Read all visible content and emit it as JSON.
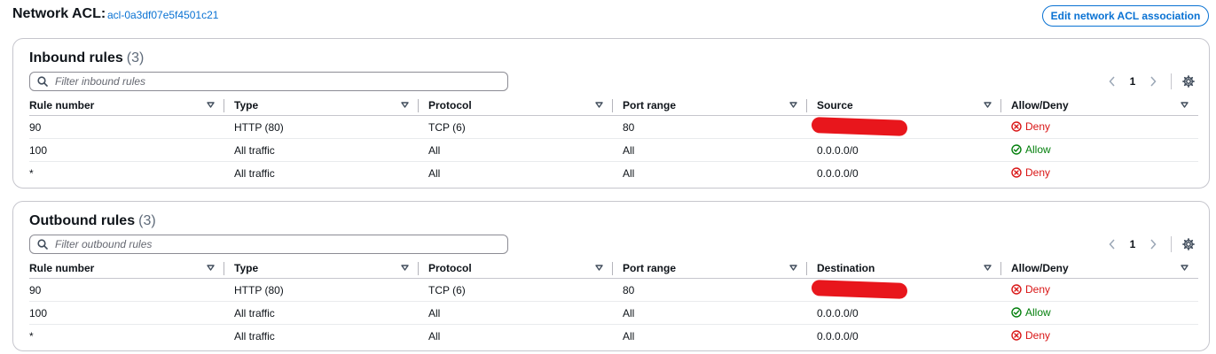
{
  "header": {
    "title": "Network ACL:",
    "acl_id": "acl-0a3df07e5f4501c21",
    "edit_button": "Edit network ACL association"
  },
  "inbound": {
    "title": "Inbound rules",
    "count": "(3)",
    "filter_placeholder": "Filter inbound rules",
    "page": "1",
    "columns": [
      "Rule number",
      "Type",
      "Protocol",
      "Port range",
      "Source",
      "Allow/Deny"
    ],
    "rows": [
      {
        "rule": "90",
        "type": "HTTP (80)",
        "protocol": "TCP (6)",
        "port": "80",
        "addr": "",
        "addr_redacted": true,
        "action": "Deny"
      },
      {
        "rule": "100",
        "type": "All traffic",
        "protocol": "All",
        "port": "All",
        "addr": "0.0.0.0/0",
        "addr_redacted": false,
        "action": "Allow"
      },
      {
        "rule": "*",
        "type": "All traffic",
        "protocol": "All",
        "port": "All",
        "addr": "0.0.0.0/0",
        "addr_redacted": false,
        "action": "Deny"
      }
    ]
  },
  "outbound": {
    "title": "Outbound rules",
    "count": "(3)",
    "filter_placeholder": "Filter outbound rules",
    "page": "1",
    "columns": [
      "Rule number",
      "Type",
      "Protocol",
      "Port range",
      "Destination",
      "Allow/Deny"
    ],
    "rows": [
      {
        "rule": "90",
        "type": "HTTP (80)",
        "protocol": "TCP (6)",
        "port": "80",
        "addr": "",
        "addr_redacted": true,
        "action": "Deny"
      },
      {
        "rule": "100",
        "type": "All traffic",
        "protocol": "All",
        "port": "All",
        "addr": "0.0.0.0/0",
        "addr_redacted": false,
        "action": "Allow"
      },
      {
        "rule": "*",
        "type": "All traffic",
        "protocol": "All",
        "port": "All",
        "addr": "0.0.0.0/0",
        "addr_redacted": false,
        "action": "Deny"
      }
    ]
  },
  "colors": {
    "link": "#0972d3",
    "deny": "#d91515",
    "allow": "#037f0c",
    "redaction": "#e8161c"
  },
  "icons": {
    "search": "search-icon",
    "sort": "caret-down-icon",
    "prev": "chevron-left-icon",
    "next": "chevron-right-icon",
    "settings": "gear-icon",
    "deny": "x-circle-icon",
    "allow": "check-circle-icon"
  }
}
